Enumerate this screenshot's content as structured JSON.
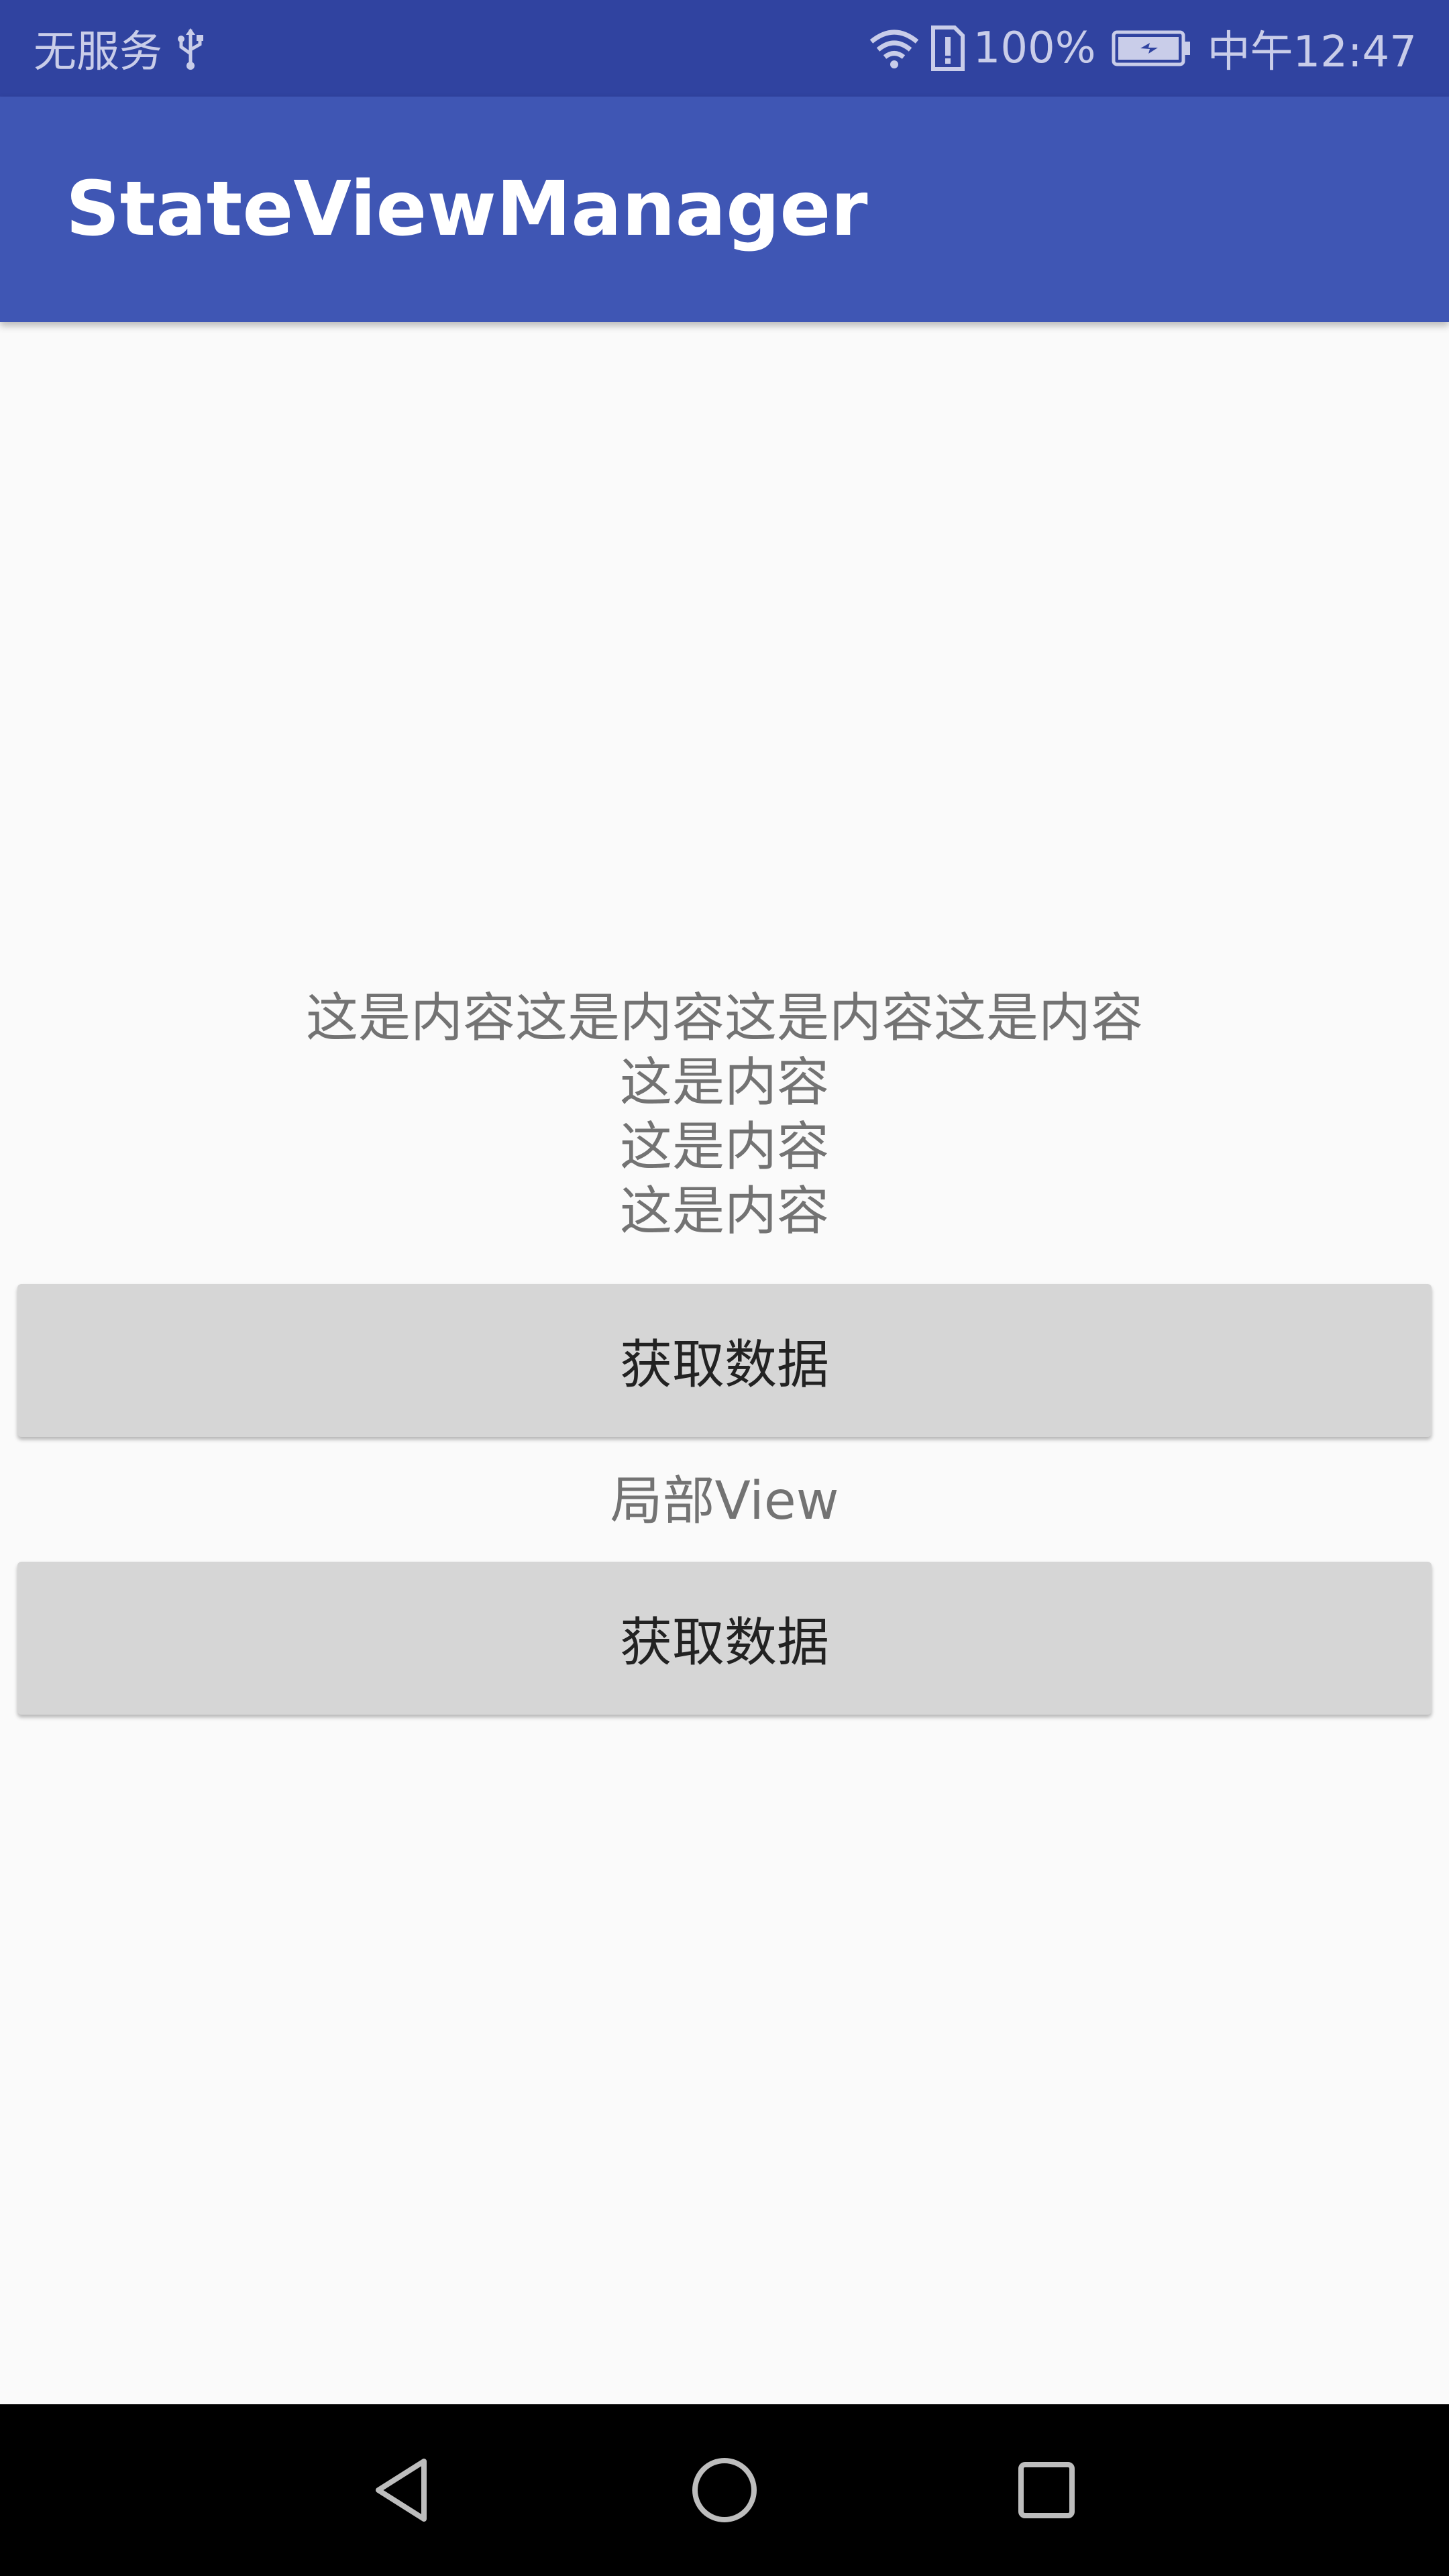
{
  "status_bar": {
    "carrier": "无服务",
    "battery_percent": "100%",
    "time": "中午12:47",
    "icons": [
      "usb-icon",
      "wifi-icon",
      "sim-alert-icon",
      "battery-charging-icon"
    ]
  },
  "app_bar": {
    "title": "StateViewManager"
  },
  "content": {
    "lines": [
      "这是内容这是内容这是内容这是内容",
      "这是内容",
      "这是内容",
      "这是内容"
    ],
    "button1_label": "获取数据",
    "partial_view_label": "局部View",
    "button2_label": "获取数据"
  },
  "nav_bar": {
    "icons": [
      "back-icon",
      "home-icon",
      "recent-apps-icon"
    ]
  },
  "colors": {
    "status_bar": "#3043a0",
    "app_bar": "#3f56b4",
    "background": "#fafafa",
    "button": "#d6d6d6",
    "content_text": "#737373"
  }
}
